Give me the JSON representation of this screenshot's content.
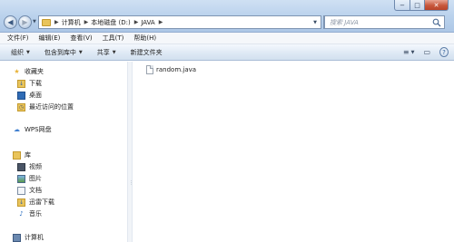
{
  "window": {
    "controls": {
      "minimize": "−",
      "maximize": "□",
      "close": "✕"
    }
  },
  "address": {
    "separator": "▶",
    "crumbs": [
      "计算机",
      "本地磁盘 (D:)",
      "JAVA"
    ],
    "refresh_icon": "refresh-icon"
  },
  "search": {
    "placeholder": "搜索 JAVA"
  },
  "menu": {
    "items": [
      "文件(F)",
      "编辑(E)",
      "查看(V)",
      "工具(T)",
      "帮助(H)"
    ]
  },
  "toolbar": {
    "buttons": [
      {
        "label": "组织",
        "dropdown": true
      },
      {
        "label": "包含到库中",
        "dropdown": true
      },
      {
        "label": "共享",
        "dropdown": true
      },
      {
        "label": "新建文件夹",
        "dropdown": false
      }
    ],
    "view_icon": "≡",
    "view_arrow": "▼",
    "preview_icon": "▭",
    "help_icon": "?"
  },
  "sidebar": {
    "favorites": {
      "label": "收藏夹",
      "items": [
        {
          "label": "下载",
          "icon": "download-icon"
        },
        {
          "label": "桌面",
          "icon": "desktop-icon"
        },
        {
          "label": "最近访问的位置",
          "icon": "recent-places-icon"
        }
      ]
    },
    "wps": {
      "label": "WPS网盘"
    },
    "libraries": {
      "label": "库",
      "items": [
        {
          "label": "视频",
          "icon": "video-icon"
        },
        {
          "label": "图片",
          "icon": "picture-icon"
        },
        {
          "label": "文档",
          "icon": "document-icon"
        },
        {
          "label": "迅雷下载",
          "icon": "thunder-download-icon"
        },
        {
          "label": "音乐",
          "icon": "music-icon"
        }
      ]
    },
    "computer": {
      "label": "计算机"
    }
  },
  "files": [
    {
      "name": "random.java",
      "icon": "java-file-icon"
    }
  ],
  "colors": {
    "titlebar": "#b9d1ec",
    "toolbar": "#dde8f4",
    "favorites_star": "#e8b33a",
    "folder": "#e9c45b"
  }
}
